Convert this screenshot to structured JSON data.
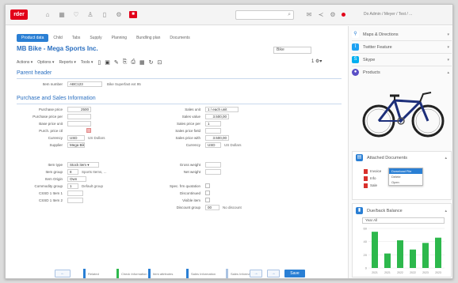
{
  "colors": {
    "accent": "#2a7fd4",
    "brand": "#e2001a",
    "chart_bar": "#2db84c"
  },
  "topbar": {
    "logo": "rder",
    "icons": [
      "home-icon",
      "grid-icon",
      "heart-icon",
      "person-icon",
      "document-icon",
      "gear-icon",
      "camera-icon"
    ],
    "search_placeholder": "",
    "right_icons": [
      "mail-icon",
      "share-icon",
      "gear-icon"
    ],
    "user": "Do Admin / Meyer / Test / ..."
  },
  "tabs": [
    "Product data",
    "Child",
    "Tabs",
    "Supply",
    "Planning",
    "Bundling plan",
    "Documents"
  ],
  "title": "MB Bike - Mega Sports Inc.",
  "title_field": "Bike",
  "toolbar": {
    "actions": "Actions ▾",
    "options": "Options ▾",
    "reports": "Reports ▾",
    "tools": "Tools ▾",
    "right": "1 ⚙▾"
  },
  "header_section": {
    "title": "Parent header",
    "item_number_label": "Item number",
    "item_number": "ABC123",
    "item_desc": "Bike Superfast ext 95"
  },
  "purchase_section": {
    "title": "Purchase and Sales Information",
    "left": [
      {
        "label": "Purchase price",
        "value": "2500"
      },
      {
        "label": "Purchase price per",
        "value": ""
      },
      {
        "label": "Base price unit",
        "value": ""
      },
      {
        "label": "Purch. price ctl",
        "value": ""
      },
      {
        "label": "Currency",
        "value": "USD",
        "note": "US Dollars"
      },
      {
        "label": "Supplier",
        "value": "Mega Bik"
      }
    ],
    "right": [
      {
        "label": "Sales unit",
        "value": "1 / each unit"
      },
      {
        "label": "Sales value",
        "value": "3.500,00"
      },
      {
        "label": "Sales price per",
        "value": "1"
      },
      {
        "label": "Sales price field",
        "value": ""
      },
      {
        "label": "Sales price with",
        "value": "3.500,00"
      },
      {
        "label": "Currency",
        "value": "USD",
        "note": "US Dollars"
      }
    ]
  },
  "classification": {
    "left": [
      {
        "label": "Item type",
        "value": "Stock item ▾"
      },
      {
        "label": "Item group",
        "value": "8",
        "note": "Sports Items, ..."
      },
      {
        "label": "Item Origin",
        "value": "Own"
      },
      {
        "label": "Commodity group",
        "value": "1",
        "note": "Default group"
      },
      {
        "label": "CSSD 1 Item 1",
        "value": ""
      },
      {
        "label": "CSSD 1 Item 2",
        "value": ""
      }
    ],
    "right": [
      {
        "label": "Gross weight",
        "value": ""
      },
      {
        "label": "Net weight",
        "value": ""
      },
      {
        "label": "Spec. frm quotation",
        "value": ""
      },
      {
        "label": "Discontinued",
        "value": ""
      },
      {
        "label": "Visible item",
        "value": ""
      },
      {
        "label": "Discount group",
        "value": "00",
        "note": "No discount"
      }
    ]
  },
  "bottom": {
    "back": "←",
    "next": "→",
    "forward": "→",
    "save": "Save",
    "items": [
      "Related",
      "Check Information",
      "Item attributes",
      "Sales Information",
      "Sales Information"
    ]
  },
  "right_panel": {
    "widgets": [
      {
        "label": "Maps & Directions",
        "icon": "map-pin-icon",
        "color": "#2a7fd4"
      },
      {
        "label": "Twitter Feature",
        "icon": "twitter-icon",
        "color": "#1da1f2"
      },
      {
        "label": "Skype",
        "icon": "skype-icon",
        "color": "#00aff0"
      },
      {
        "label": "Products",
        "icon": "products-icon",
        "color": "#5a4fc6"
      }
    ],
    "attached": {
      "title": "Attached Documents",
      "rows": [
        "Invoice",
        "Info",
        "Sale"
      ],
      "menu": [
        "Download File",
        "Delete",
        "Open"
      ]
    },
    "outstanding": {
      "title": "Due/back Balance",
      "select": "Year All"
    }
  },
  "chart_data": {
    "type": "bar",
    "categories": [
      "2021",
      "2021",
      "2022",
      "2022",
      "2023",
      "2023"
    ],
    "values": [
      55,
      22,
      42,
      28,
      38,
      46
    ],
    "title": "",
    "xlabel": "",
    "ylabel": "",
    "ylim": [
      0,
      60
    ],
    "grid": true,
    "legend": "none"
  }
}
